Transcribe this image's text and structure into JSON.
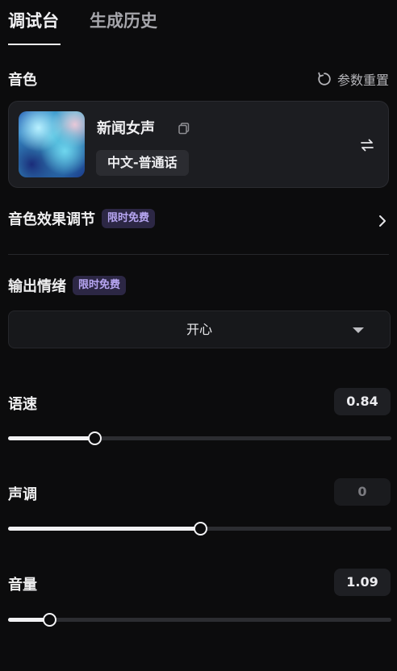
{
  "tabs": [
    {
      "label": "调试台",
      "active": true
    },
    {
      "label": "生成历史",
      "active": false
    }
  ],
  "voice_section": {
    "title": "音色",
    "reset_label": "参数重置",
    "voice": {
      "name": "新闻女声",
      "tag": "中文-普通话"
    }
  },
  "effect": {
    "title": "音色效果调节",
    "badge": "限时免费"
  },
  "emotion": {
    "title": "输出情绪",
    "badge": "限时免费",
    "selected": "开心"
  },
  "sliders": {
    "speed": {
      "label": "语速",
      "value": "0.84",
      "fraction": 0.225
    },
    "pitch": {
      "label": "声调",
      "value": "0",
      "fraction": 0.5
    },
    "volume": {
      "label": "音量",
      "value": "1.09",
      "fraction": 0.108
    }
  },
  "colors": {
    "background": "#0c0c0d",
    "badge_bg": "#2c2744",
    "badge_text": "#b7a6f2",
    "track": "#2c2d31",
    "fill": "#f1f1f3"
  },
  "icons": {
    "reset": "reset-icon",
    "copy": "copy-icon",
    "swap": "swap-icon",
    "chevron": "chevron-right-icon",
    "dropdown": "caret-down-icon"
  }
}
